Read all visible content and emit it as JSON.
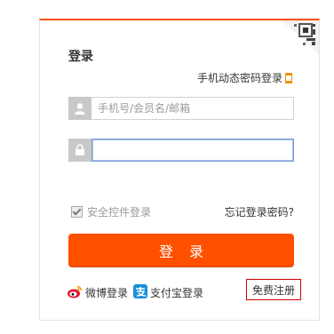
{
  "login": {
    "title": "登录",
    "dynamic_password_login": "手机动态密码登录",
    "username_placeholder": "手机号/会员名/邮箱",
    "password_value": "",
    "safe_control_label": "安全控件登录",
    "forgot_password": "忘记登录密码?",
    "submit_label": "登录",
    "weibo_login": "微博登录",
    "alipay_login": "支付宝登录",
    "register": "免费注册"
  },
  "colors": {
    "accent": "#ff5000",
    "register_border": "#d00000",
    "icon_bg": "#c9c9c9"
  },
  "icons": {
    "qr": "qr-code-icon",
    "phone": "phone-icon",
    "user": "user-icon",
    "lock": "lock-icon",
    "weibo": "weibo-icon",
    "alipay": "alipay-icon"
  }
}
